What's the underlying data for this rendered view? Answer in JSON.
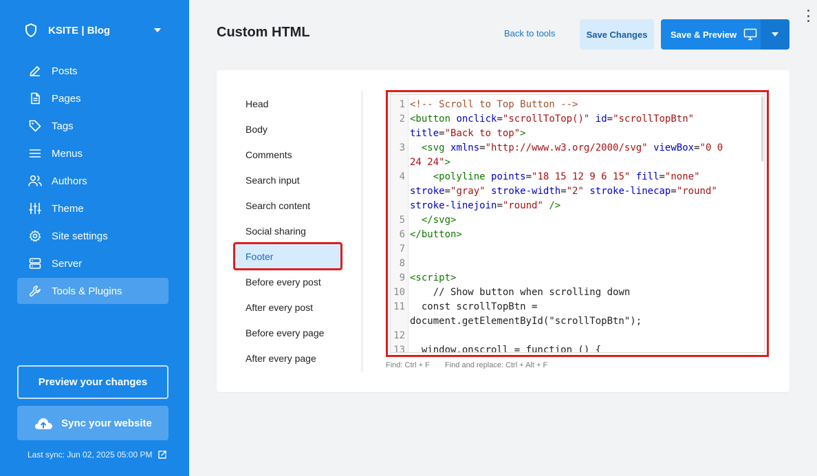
{
  "sidebar": {
    "site_name": "KSITE | Blog",
    "items": [
      {
        "label": "Posts",
        "icon": "pencil-icon"
      },
      {
        "label": "Pages",
        "icon": "page-icon"
      },
      {
        "label": "Tags",
        "icon": "tag-icon"
      },
      {
        "label": "Menus",
        "icon": "menu-icon"
      },
      {
        "label": "Authors",
        "icon": "authors-icon"
      },
      {
        "label": "Theme",
        "icon": "sliders-icon"
      },
      {
        "label": "Site settings",
        "icon": "gear-icon"
      },
      {
        "label": "Server",
        "icon": "server-icon"
      },
      {
        "label": "Tools & Plugins",
        "icon": "wrench-icon",
        "active": true
      }
    ],
    "preview_label": "Preview your changes",
    "sync_label": "Sync your website",
    "last_sync": "Last sync: Jun 02, 2025 05:00 PM"
  },
  "header": {
    "title": "Custom HTML",
    "back_label": "Back to tools",
    "save_changes_label": "Save Changes",
    "save_preview_label": "Save & Preview"
  },
  "sections": [
    "Head",
    "Body",
    "Comments",
    "Search input",
    "Search content",
    "Social sharing",
    "Footer",
    "Before every post",
    "After every post",
    "Before every page",
    "After every page"
  ],
  "active_section": "Footer",
  "editor": {
    "lines": [
      {
        "n": "1",
        "segments": [
          [
            "c-comment",
            "<!-- Scroll to Top Button -->"
          ]
        ]
      },
      {
        "n": "2",
        "segments": [
          [
            "c-tag",
            "<button"
          ],
          [
            "c-plain",
            " "
          ],
          [
            "c-attr",
            "onclick"
          ],
          [
            "c-plain",
            "="
          ],
          [
            "c-str",
            "\"scrollToTop()\""
          ],
          [
            "c-plain",
            " "
          ],
          [
            "c-attr",
            "id"
          ],
          [
            "c-plain",
            "="
          ],
          [
            "c-str",
            "\"scrollTopBtn\""
          ],
          [
            "c-plain",
            "\n"
          ],
          [
            "c-attr",
            "title"
          ],
          [
            "c-plain",
            "="
          ],
          [
            "c-str",
            "\"Back to top\""
          ],
          [
            "c-tag",
            ">"
          ]
        ]
      },
      {
        "n": "3",
        "segments": [
          [
            "c-plain",
            "  "
          ],
          [
            "c-tag",
            "<svg"
          ],
          [
            "c-plain",
            " "
          ],
          [
            "c-attr",
            "xmlns"
          ],
          [
            "c-plain",
            "="
          ],
          [
            "c-str",
            "\"http://www.w3.org/2000/svg\""
          ],
          [
            "c-plain",
            " "
          ],
          [
            "c-attr",
            "viewBox"
          ],
          [
            "c-plain",
            "="
          ],
          [
            "c-str",
            "\"0 0\n24 24\""
          ],
          [
            "c-tag",
            ">"
          ]
        ]
      },
      {
        "n": "4",
        "segments": [
          [
            "c-plain",
            "    "
          ],
          [
            "c-tag",
            "<polyline"
          ],
          [
            "c-plain",
            " "
          ],
          [
            "c-attr",
            "points"
          ],
          [
            "c-plain",
            "="
          ],
          [
            "c-str",
            "\"18 15 12 9 6 15\""
          ],
          [
            "c-plain",
            " "
          ],
          [
            "c-attr",
            "fill"
          ],
          [
            "c-plain",
            "="
          ],
          [
            "c-str",
            "\"none\""
          ],
          [
            "c-plain",
            "\n"
          ],
          [
            "c-attr",
            "stroke"
          ],
          [
            "c-plain",
            "="
          ],
          [
            "c-str",
            "\"gray\""
          ],
          [
            "c-plain",
            " "
          ],
          [
            "c-attr",
            "stroke-width"
          ],
          [
            "c-plain",
            "="
          ],
          [
            "c-str",
            "\"2\""
          ],
          [
            "c-plain",
            " "
          ],
          [
            "c-attr",
            "stroke-linecap"
          ],
          [
            "c-plain",
            "="
          ],
          [
            "c-str",
            "\"round\""
          ],
          [
            "c-plain",
            "\n"
          ],
          [
            "c-attr",
            "stroke-linejoin"
          ],
          [
            "c-plain",
            "="
          ],
          [
            "c-str",
            "\"round\""
          ],
          [
            "c-plain",
            " "
          ],
          [
            "c-tag",
            "/>"
          ]
        ]
      },
      {
        "n": "5",
        "segments": [
          [
            "c-plain",
            "  "
          ],
          [
            "c-tag",
            "</svg>"
          ]
        ]
      },
      {
        "n": "6",
        "segments": [
          [
            "c-tag",
            "</button>"
          ]
        ]
      },
      {
        "n": "7",
        "segments": [
          [
            "c-plain",
            " "
          ]
        ]
      },
      {
        "n": "8",
        "segments": [
          [
            "c-plain",
            " "
          ]
        ]
      },
      {
        "n": "9",
        "segments": [
          [
            "c-tag",
            "<script>"
          ]
        ]
      },
      {
        "n": "10",
        "segments": [
          [
            "c-plain",
            "    // Show button when scrolling down"
          ]
        ]
      },
      {
        "n": "11",
        "segments": [
          [
            "c-plain",
            "  const scrollTopBtn =\ndocument.getElementById(\"scrollTopBtn\");"
          ]
        ]
      },
      {
        "n": "12",
        "segments": [
          [
            "c-plain",
            " "
          ]
        ]
      },
      {
        "n": "13",
        "segments": [
          [
            "c-plain",
            "  window.onscroll = function () {"
          ]
        ]
      }
    ],
    "find_hint": "Find: Ctrl + F",
    "replace_hint": "Find and replace: Ctrl + Alt + F"
  }
}
